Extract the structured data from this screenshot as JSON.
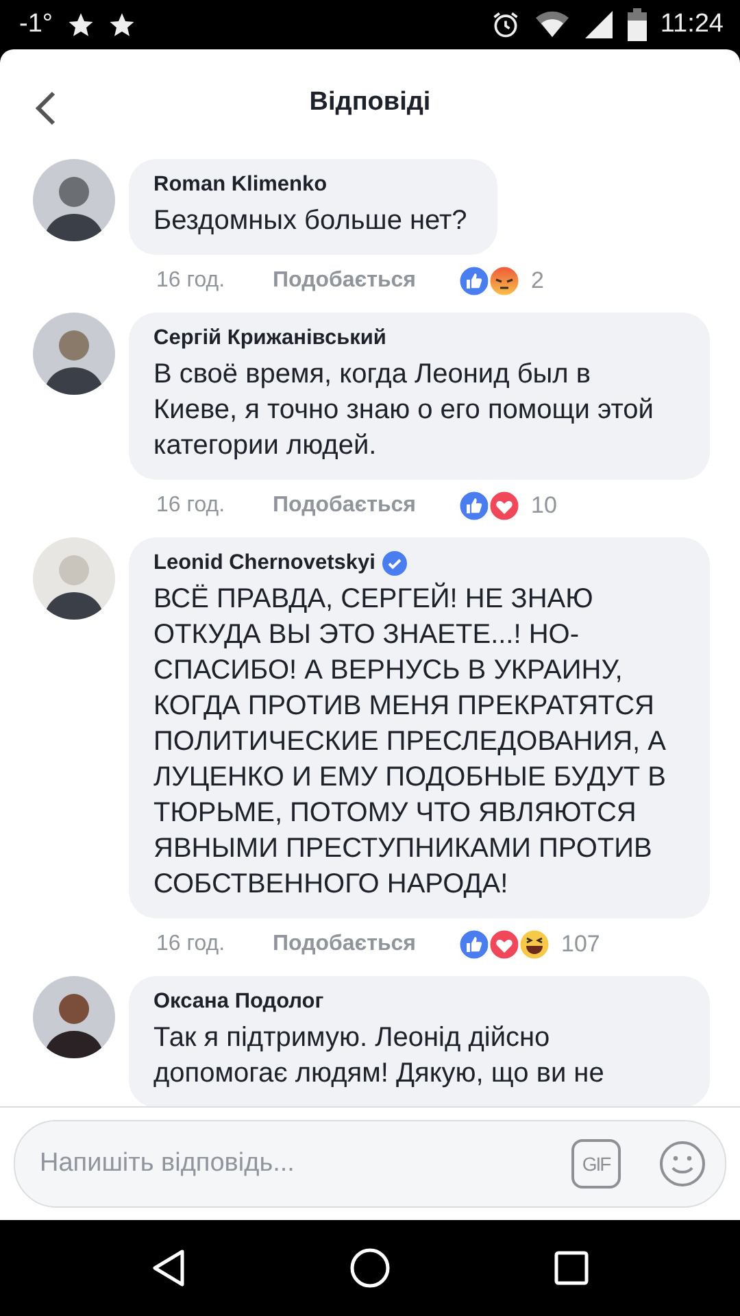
{
  "status_bar": {
    "temperature": "-1°",
    "time": "11:24"
  },
  "header": {
    "title": "Відповіді"
  },
  "comments": [
    {
      "author": "Roman Klimenko",
      "verified": false,
      "text": "Бездомных больше нет?",
      "time": "16 год.",
      "like_label": "Подобається",
      "reactions": [
        {
          "kind": "like"
        },
        {
          "kind": "angry"
        }
      ],
      "reaction_count": "2"
    },
    {
      "author": "Сергій Крижанівський",
      "verified": false,
      "text": "В своё время, когда Леонид был в Киеве, я точно знаю о его помощи этой категории людей.",
      "time": "16 год.",
      "like_label": "Подобається",
      "reactions": [
        {
          "kind": "like"
        },
        {
          "kind": "love"
        }
      ],
      "reaction_count": "10"
    },
    {
      "author": "Leonid Chernovetskyi",
      "verified": true,
      "text": "ВСЁ ПРАВДА, СЕРГЕЙ! НЕ ЗНАЮ ОТКУДА ВЫ ЭТО ЗНАЕТЕ...! НО- СПАСИБО! А ВЕРНУСЬ В УКРАИНУ, КОГДА ПРОТИВ МЕНЯ ПРЕКРАТЯТСЯ ПОЛИТИЧЕСКИЕ ПРЕСЛЕДОВАНИЯ, А ЛУЦЕНКО И ЕМУ ПОДОБНЫЕ БУДУТ В ТЮРЬМЕ, ПОТОМУ ЧТО ЯВЛЯЮТСЯ ЯВНЫМИ ПРЕСТУПНИКАМИ ПРОТИВ СОБСТВЕННОГО НАРОДА!",
      "time": "16 год.",
      "like_label": "Подобається",
      "reactions": [
        {
          "kind": "like"
        },
        {
          "kind": "love"
        },
        {
          "kind": "haha"
        }
      ],
      "reaction_count": "107"
    },
    {
      "author": "Оксана Подолог",
      "verified": false,
      "text": "Так я підтримую. Леонід дійсно допомогає людям! Дякую, що ви не"
    }
  ],
  "composer": {
    "placeholder": "Напишіть відповідь...",
    "gif_label": "GIF"
  }
}
